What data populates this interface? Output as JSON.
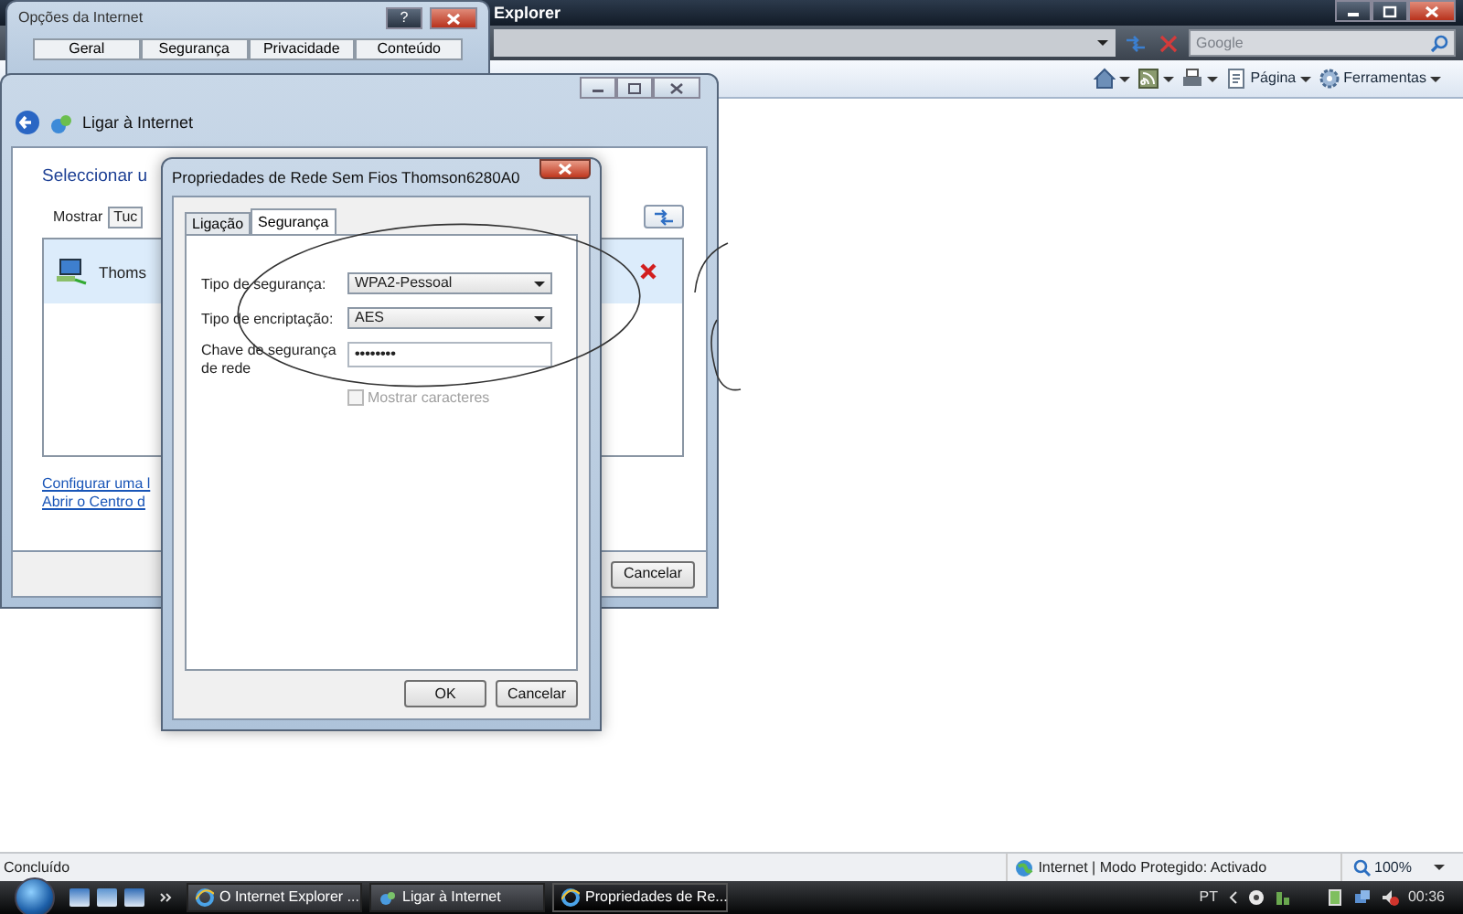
{
  "browser": {
    "title": "Explorer",
    "search": {
      "placeholder": "Google"
    },
    "command_bar": [
      "Página",
      "Ferramentas"
    ],
    "status_bar": {
      "status": "Concluído",
      "zone": "Internet | Modo Protegido: Activado",
      "zoom": "100%"
    }
  },
  "internet_options": {
    "title": "Opções da Internet",
    "help": "?",
    "tabs": [
      {
        "label": "Geral",
        "selected": false
      },
      {
        "label": "Segurança",
        "selected": false
      },
      {
        "label": "Privacidade",
        "selected": false
      },
      {
        "label": "Conteúdo",
        "selected": false
      }
    ]
  },
  "connect_window": {
    "title": "Ligar à Internet",
    "heading": "Seleccionar u",
    "show_label": "Mostrar",
    "show_value": "Tuc",
    "networks": [
      {
        "name": "Thoms",
        "selected": true
      }
    ],
    "links": [
      "Configurar uma l",
      "Abrir o Centro d"
    ],
    "cancel": "Cancelar"
  },
  "properties_dialog": {
    "title": "Propriedades de Rede Sem Fios Thomson6280A0",
    "tabs": [
      {
        "label": "Ligação",
        "selected": false
      },
      {
        "label": "Segurança",
        "selected": true
      }
    ],
    "fields": [
      {
        "kind": "select",
        "label": "Tipo de segurança:",
        "value": "WPA2-Pessoal"
      },
      {
        "kind": "select",
        "label": "Tipo de encriptação:",
        "value": "AES"
      },
      {
        "kind": "password",
        "label": "Chave de segurança de rede",
        "value": "••••••••"
      }
    ],
    "show_characters": {
      "label": "Mostrar caracteres",
      "checked": false,
      "disabled": true
    },
    "buttons": [
      "OK",
      "Cancelar"
    ]
  },
  "taskbar": {
    "buttons": [
      {
        "label": "O Internet Explorer ...",
        "selected": false
      },
      {
        "label": "Ligar à Internet",
        "selected": false
      },
      {
        "label": "Propriedades de Re...",
        "selected": true
      }
    ],
    "language": "PT",
    "clock": "00:36"
  }
}
